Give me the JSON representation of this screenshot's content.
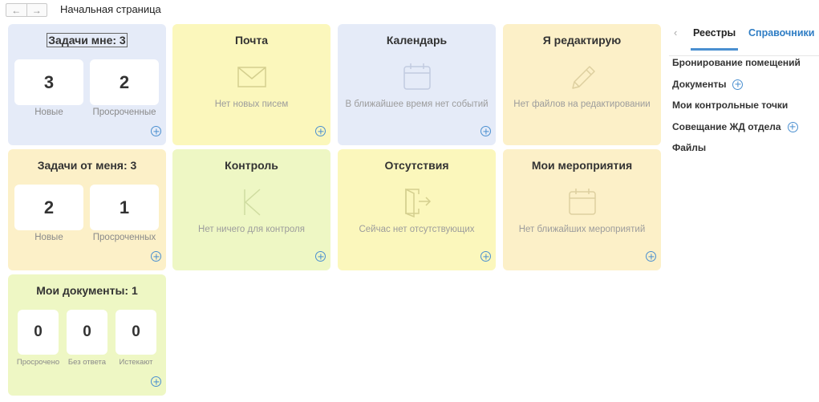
{
  "header": {
    "back_icon": "arrow-left-icon",
    "forward_icon": "arrow-right-icon",
    "title": "Начальная страница"
  },
  "tiles": {
    "my_tasks": {
      "title": "Задачи мне: 3",
      "counters": [
        {
          "value": "3",
          "label": "Новые"
        },
        {
          "value": "2",
          "label": "Просроченные"
        }
      ]
    },
    "mail": {
      "title": "Почта",
      "icon": "envelope-icon",
      "message": "Нет новых писем"
    },
    "calendar": {
      "title": "Календарь",
      "icon": "calendar-icon",
      "message": "В ближайшее время нет событий"
    },
    "editing": {
      "title": "Я редактирую",
      "icon": "pencil-icon",
      "message": "Нет файлов на редактировании"
    },
    "tasks_from_me": {
      "title": "Задачи от меня: 3",
      "counters": [
        {
          "value": "2",
          "label": "Новые"
        },
        {
          "value": "1",
          "label": "Просроченных"
        }
      ]
    },
    "control": {
      "title": "Контроль",
      "icon": "control-k-icon",
      "message": "Нет ничего для контроля"
    },
    "absences": {
      "title": "Отсутствия",
      "icon": "door-exit-icon",
      "message": "Сейчас нет отсутствующих"
    },
    "my_events": {
      "title": "Мои мероприятия",
      "icon": "calendar-icon",
      "message": "Нет ближайших мероприятий"
    },
    "my_documents": {
      "title": "Мои документы: 1",
      "counters": [
        {
          "value": "0",
          "label": "Просрочено"
        },
        {
          "value": "0",
          "label": "Без ответа"
        },
        {
          "value": "0",
          "label": "Истекают"
        }
      ]
    }
  },
  "sidebar": {
    "tabs": [
      {
        "label": "Реестры",
        "active": true
      },
      {
        "label": "Справочники",
        "active": false
      }
    ],
    "items": [
      {
        "label": "Бронирование помещений",
        "has_add": false
      },
      {
        "label": "Документы",
        "has_add": true
      },
      {
        "label": "Мои контрольные точки",
        "has_add": false
      },
      {
        "label": "Совещание ЖД отдела",
        "has_add": true
      },
      {
        "label": "Файлы",
        "has_add": false
      }
    ]
  },
  "colors": {
    "blue_tile": "#e5ebf8",
    "yellow_tile": "#fbf7bc",
    "sand_tile": "#fcf0c8",
    "green_tile": "#eef7c4",
    "accent": "#4a8fd0",
    "link": "#2f7dc4"
  }
}
